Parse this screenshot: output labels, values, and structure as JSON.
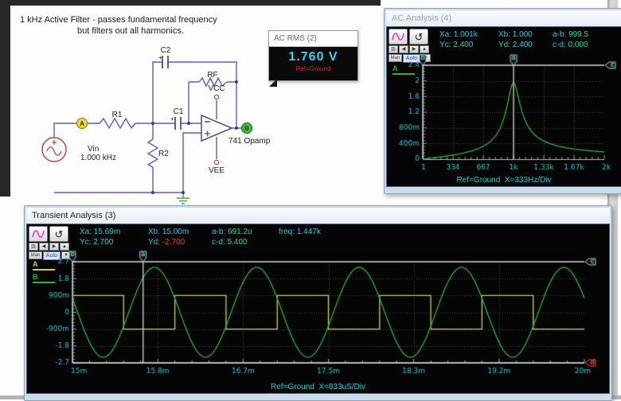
{
  "circuit": {
    "title_line1": "1 kHz Active Filter - passes fundamental frequency",
    "title_line2": "but filters out all harmonics.",
    "labels": {
      "c2": "C2",
      "rf": "RF",
      "vcc": "VCC",
      "vee": "VEE",
      "r1": "R1",
      "c1": "C1",
      "r2": "R2",
      "vin_name": "Vin",
      "vin_freq": "1.000 kHz",
      "opamp": "741 Opamp",
      "probe_a": "A",
      "probe_b": "B"
    },
    "wire_color": "#5b5bc4",
    "source_color": "#c04040",
    "ground_color": "#4aa84a",
    "probe_a_color": "#ecd93a",
    "probe_b_color": "#46c43a"
  },
  "probe_box": {
    "title": "AC RMS (2)",
    "value": "1.760 V",
    "ref": "Ref=Ground"
  },
  "analysis_toolbar": {
    "mini": [
      "▥",
      "◀",
      "▶",
      "▲"
    ],
    "man": "Man",
    "auto": "Auto",
    "drop": "▼",
    "reset": "↺"
  },
  "ac_window": {
    "title": "AC Analysis (4)",
    "readout": {
      "xa_label": "Xa:",
      "xa": "1.001k",
      "xb_label": "Xb:",
      "xb": "1.000",
      "ab_label": "a-b:",
      "ab": "999.5",
      "yc_label": "Yc:",
      "yc": "2.400",
      "yd_label": "Yd:",
      "yd": "2.400",
      "cd_label": "c-d:",
      "cd": "0.000"
    },
    "legend": [
      {
        "name": "A",
        "color": "#2eb437"
      }
    ],
    "footer": "Ref=Ground  X=333Hz/Div"
  },
  "tr_window": {
    "title": "Transient Analysis (3)",
    "readout": {
      "xa_label": "Xa:",
      "xa": "15.69m",
      "xb_label": "Xb:",
      "xb": "15.00m",
      "ab_label": "a-b:",
      "ab": "691.2u",
      "freq_label": "freq:",
      "freq": "1.447k",
      "yc_label": "Yc:",
      "yc": "2.700",
      "yd_label": "Yd:",
      "yd": "-2.700",
      "cd_label": "c-d:",
      "cd": "5.400"
    },
    "legend": [
      {
        "name": "A",
        "color": "#cfcf52"
      },
      {
        "name": "B",
        "color": "#2eb437"
      }
    ],
    "footer": "Ref=Ground  X=833uS/Div"
  },
  "chart_data": [
    {
      "id": "ac",
      "type": "line",
      "title": "AC Analysis (4)",
      "xlabel": "Ref=Ground X=333Hz/Div",
      "ylabel": "",
      "x_ticks": [
        "1",
        "334",
        "667",
        "1k",
        "1.33k",
        "1.67k",
        "2k"
      ],
      "x_range": [
        1,
        2000
      ],
      "y_ticks": [
        "2.4",
        "2",
        "1.6",
        "1.2",
        "800m",
        "400m",
        "0"
      ],
      "y_range": [
        0,
        2.4
      ],
      "grid": true,
      "legend_position": "top-left",
      "series": [
        {
          "name": "A",
          "color": "#2eb437",
          "model": "bandpass_resonance",
          "f0_hz": 1000,
          "peak": 1.95,
          "q": 7,
          "samples_hz": [
            1,
            334,
            667,
            850,
            1000,
            1150,
            1330,
            1670,
            2000
          ],
          "samples_v": [
            0.01,
            0.1,
            0.33,
            0.8,
            1.95,
            0.85,
            0.47,
            0.26,
            0.18
          ]
        }
      ],
      "cursors": {
        "a": 1001,
        "b": 1,
        "c": 2.4,
        "d": 2.4
      }
    },
    {
      "id": "transient",
      "type": "line",
      "title": "Transient Analysis (3)",
      "xlabel": "Ref=Ground X=833uS/Div",
      "ylabel": "",
      "x_ticks": [
        "15m",
        "15.8m",
        "16.7m",
        "17.5m",
        "18.3m",
        "19.2m",
        "20m"
      ],
      "x_range": [
        15,
        20
      ],
      "y_ticks": [
        "2.7",
        "1.8",
        "900m",
        "0",
        "-900m",
        "-1.8",
        "-2.7"
      ],
      "y_range": [
        -2.7,
        2.7
      ],
      "grid": true,
      "legend_position": "top-left",
      "series": [
        {
          "name": "A",
          "color": "#cfcf52",
          "shape": "square",
          "freq_khz": 1.0,
          "amplitude": 0.9,
          "high_at_start": true,
          "first_fall_ms": 15.5
        },
        {
          "name": "B",
          "color": "#2eb437",
          "shape": "sine",
          "freq_khz": 1.0,
          "amplitude": 2.4,
          "peak_ms": 15.8
        }
      ],
      "cursors": {
        "a": 15.69,
        "b": 15.0,
        "c": 2.7,
        "d": -2.7
      }
    }
  ]
}
